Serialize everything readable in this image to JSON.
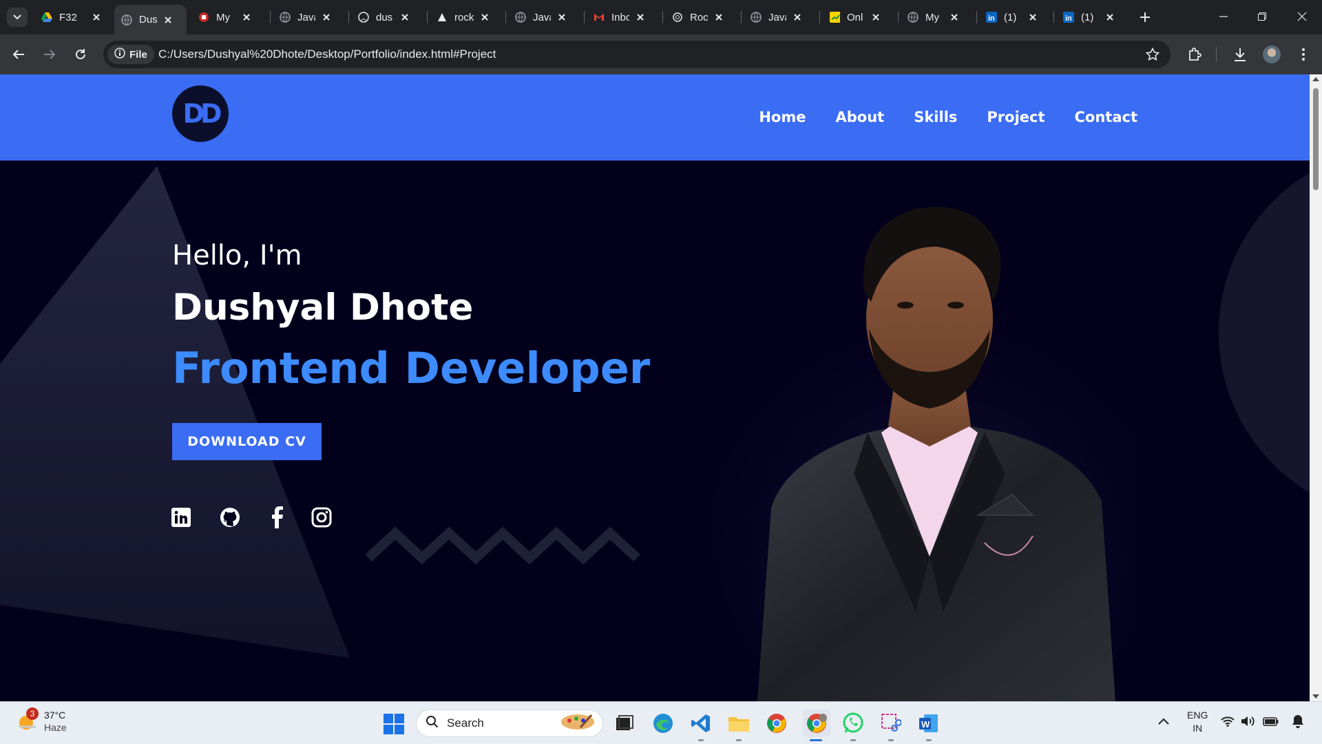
{
  "browser": {
    "tabs": [
      {
        "title": "F32",
        "icon": "google-drive-icon"
      },
      {
        "title": "Dus",
        "icon": "globe-icon",
        "active": true
      },
      {
        "title": "My",
        "icon": "app-icon"
      },
      {
        "title": "Java",
        "icon": "globe-icon"
      },
      {
        "title": "dus",
        "icon": "github-icon"
      },
      {
        "title": "rock",
        "icon": "triangle-icon"
      },
      {
        "title": "Java",
        "icon": "globe-icon"
      },
      {
        "title": "Inbo",
        "icon": "gmail-icon"
      },
      {
        "title": "Roc",
        "icon": "openai-icon"
      },
      {
        "title": "Java",
        "icon": "globe-icon"
      },
      {
        "title": "Onl",
        "icon": "notes-icon"
      },
      {
        "title": "My",
        "icon": "globe-icon"
      },
      {
        "title": "(1)",
        "icon": "linkedin-icon"
      },
      {
        "title": "(1)",
        "icon": "linkedin-icon"
      }
    ],
    "site_chip": "File",
    "url": "C:/Users/Dushyal%20Dhote/Desktop/Portfolio/index.html#Project"
  },
  "site": {
    "logo_text": "DD",
    "nav": [
      "Home",
      "About",
      "Skills",
      "Project",
      "Contact"
    ],
    "hero": {
      "greeting": "Hello, I'm",
      "name": "Dushyal Dhote",
      "role": "Frontend Developer",
      "cta": "DOWNLOAD CV"
    },
    "social": [
      "linkedin-icon",
      "github-icon",
      "facebook-icon",
      "instagram-icon"
    ],
    "colors": {
      "primary": "#3b6cf4",
      "background": "#03001c",
      "role_text": "#3d8bfd"
    }
  },
  "taskbar": {
    "weather": {
      "temp": "37°C",
      "condition": "Haze",
      "badge": "3"
    },
    "search_label": "Search",
    "lang_top": "ENG",
    "lang_bottom": "IN"
  }
}
